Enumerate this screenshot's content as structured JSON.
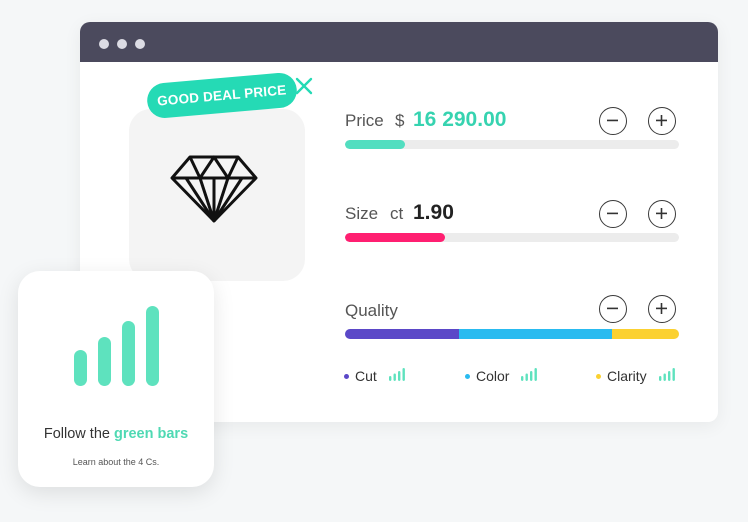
{
  "window": {
    "controls": [
      "window-dot",
      "window-dot",
      "window-dot"
    ]
  },
  "product": {
    "icon": "diamond-icon",
    "deal_tag": "GOOD DEAL PRICE",
    "close_icon": "close-icon"
  },
  "price": {
    "label": "Price",
    "currency": "$",
    "value": "16 290.00",
    "level": 0.18,
    "color": "#52dec0"
  },
  "size": {
    "label": "Size",
    "unit": "ct",
    "value": "1.90",
    "level": 0.3,
    "color": "#ff1f71"
  },
  "quality": {
    "label": "Quality",
    "segments": [
      {
        "name": "Cut",
        "fraction": 0.34,
        "color": "#5b48c8"
      },
      {
        "name": "Color",
        "fraction": 0.46,
        "color": "#29bbf0"
      },
      {
        "name": "Clarity",
        "fraction": 0.2,
        "color": "#fbd131"
      }
    ],
    "legend": [
      {
        "label": "Cut",
        "color": "#5b48c8",
        "icon": "signal-bars-icon"
      },
      {
        "label": "Color",
        "color": "#29bbf0",
        "icon": "signal-bars-icon"
      },
      {
        "label": "Clarity",
        "color": "#fbd131",
        "icon": "signal-bars-icon"
      }
    ]
  },
  "controls": {
    "minus_icon": "minus-icon",
    "plus_icon": "plus-icon"
  },
  "info_card": {
    "icon": "green-bars-icon",
    "title_prefix": "Follow the",
    "title_highlight": "green bars",
    "subtitle": "Learn about the 4 Cs."
  },
  "colors": {
    "accent": "#25dab5",
    "window_bar": "#4b4a5d",
    "bars": "#5ee2be"
  }
}
